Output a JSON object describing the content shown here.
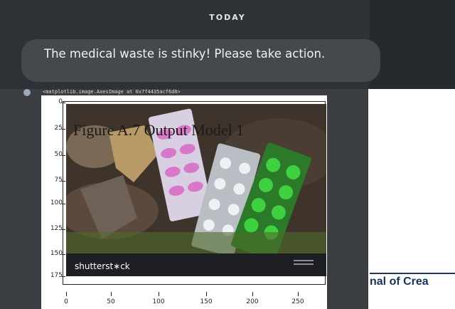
{
  "chat": {
    "date_header": "TODAY",
    "message": "The medical waste is stinky! Please take action."
  },
  "notebook": {
    "output_repr": "<matplotlib.image.AxesImage at 0x7f4435acf6d0>"
  },
  "figure": {
    "caption": "Figure A.7 Output Model 1",
    "watermark": "shutterst∗ck",
    "y_ticks": [
      "0",
      "25",
      "50",
      "75",
      "100",
      "125",
      "150",
      "175"
    ],
    "x_ticks": [
      "0",
      "50",
      "100",
      "150",
      "200",
      "250"
    ]
  },
  "journal": {
    "text": "nal of Crea"
  },
  "colors": {
    "chat_background": "#2e3135",
    "bubble": "#45484d",
    "journal_blue": "#17335a"
  }
}
